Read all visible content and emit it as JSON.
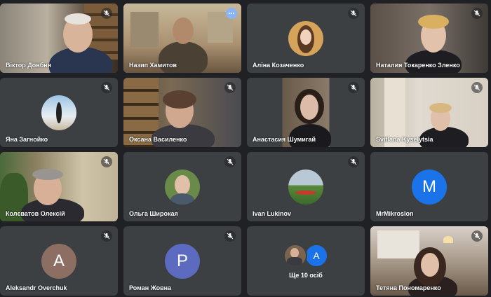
{
  "tiles": [
    {
      "name": "Віктор Довбня",
      "muted": true
    },
    {
      "name": "Назип Хамитов",
      "muted": false,
      "more": "more-options"
    },
    {
      "name": "Аліна Козаченко",
      "muted": true
    },
    {
      "name": "Наталия Токаренко Зленко",
      "muted": true
    },
    {
      "name": "Яна Загнойко",
      "muted": true
    },
    {
      "name": "Оксана Василенко",
      "muted": true
    },
    {
      "name": "Анастасия Шумигай",
      "muted": true
    },
    {
      "name": "Svitlana Kyselytsia",
      "muted": true
    },
    {
      "name": "Колєватов Олексій",
      "muted": true
    },
    {
      "name": "Ольга Широкая",
      "muted": true
    },
    {
      "name": "Ivan Lukinov",
      "muted": true
    },
    {
      "name": "MrMikroslon",
      "muted": false,
      "initial": "M",
      "color": "#1a73e8"
    },
    {
      "name": "Aleksandr Overchuk",
      "muted": true,
      "initial": "A",
      "color": "#8d6e63"
    },
    {
      "name": "Роман Жовна",
      "muted": true,
      "initial": "P",
      "color": "#5c6bc0"
    },
    {
      "name": "Ще 10 осіб",
      "more_initial": "A",
      "more_color": "#1a73e8"
    },
    {
      "name": "Тетяна Пономаренко",
      "muted": true
    }
  ],
  "colors": {
    "background": "#202124",
    "tile": "#3c4043",
    "accent": "#8ab4f8"
  }
}
